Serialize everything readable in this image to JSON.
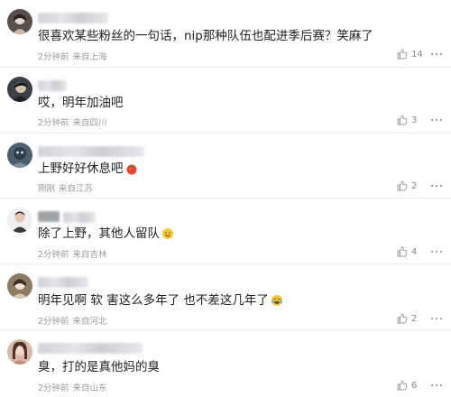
{
  "comments": [
    {
      "text": "很喜欢某些粉丝的一句话，nip那种队伍也配进季后赛？笑麻了",
      "time": "2分钟前",
      "location": "来自上海",
      "likes": "14"
    },
    {
      "text": "哎，明年加油吧",
      "time": "2分钟前",
      "location": "来自四川",
      "likes": "3"
    },
    {
      "text": "上野好好休息吧",
      "time": "刚刚",
      "location": "来自江苏",
      "likes": "2",
      "emoji": "tomato-emoji"
    },
    {
      "text": "除了上野，其他人留队",
      "time": "2分钟前",
      "location": "来自吉林",
      "likes": "4",
      "emoji": "smile-emoji"
    },
    {
      "text": "明年见啊 软 害这么多年了 也不差这几年了",
      "time": "2分钟前",
      "location": "来自河北",
      "likes": "2",
      "emoji": "tears-of-joy-emoji"
    },
    {
      "text": "臭，打的是真他妈的臭",
      "time": "2分钟前",
      "location": "来自山东",
      "likes": "6"
    }
  ],
  "icons": {
    "like": "thumbs-up-icon",
    "more": "more-dots-icon"
  },
  "colors": {
    "text": "#222222",
    "meta": "#9a9a9a",
    "divider": "#ececec"
  }
}
